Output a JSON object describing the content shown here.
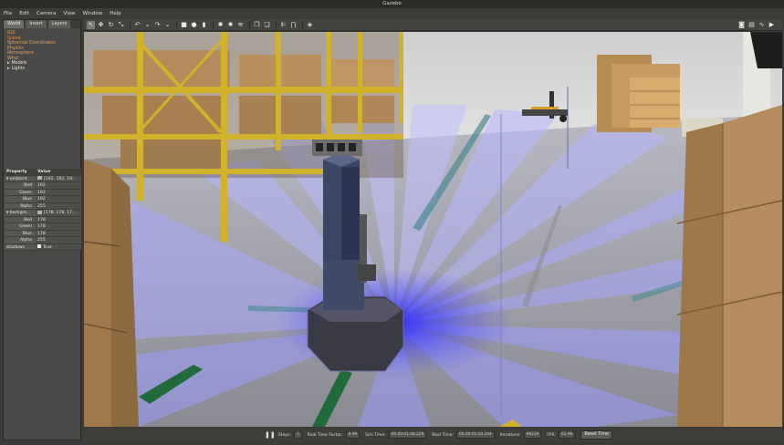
{
  "window": {
    "title": "Gazebo"
  },
  "menu": [
    "File",
    "Edit",
    "Camera",
    "View",
    "Window",
    "Help"
  ],
  "left_panel": {
    "tabs": [
      "World",
      "Insert",
      "Layers"
    ],
    "tree": [
      {
        "label": "GUI",
        "style": "orange"
      },
      {
        "label": "Scene",
        "style": "selected"
      },
      {
        "label": "Spherical Coordinates",
        "style": "orange"
      },
      {
        "label": "Physics",
        "style": "orange"
      },
      {
        "label": "Atmosphere",
        "style": "orange"
      },
      {
        "label": "Wind",
        "style": "orange"
      },
      {
        "label": "Models",
        "style": "expand"
      },
      {
        "label": "Lights",
        "style": "expand"
      }
    ],
    "properties": {
      "header": {
        "property": "Property",
        "value": "Value"
      },
      "rows": [
        {
          "key": "ambient",
          "value": "[192, 192, 19...",
          "type": "group"
        },
        {
          "key": "Red",
          "value": "192",
          "type": "child"
        },
        {
          "key": "Green",
          "value": "192",
          "type": "child"
        },
        {
          "key": "Blue",
          "value": "192",
          "type": "child"
        },
        {
          "key": "Alpha",
          "value": "255",
          "type": "child"
        },
        {
          "key": "backgro...",
          "value": "[178, 178, 17...",
          "type": "group"
        },
        {
          "key": "Red",
          "value": "178",
          "type": "child"
        },
        {
          "key": "Green",
          "value": "178",
          "type": "child"
        },
        {
          "key": "Blue",
          "value": "178",
          "type": "child"
        },
        {
          "key": "Alpha",
          "value": "255",
          "type": "child"
        },
        {
          "key": "shadows",
          "value": "True",
          "type": "check"
        }
      ]
    }
  },
  "toolbar": {
    "tools": [
      {
        "name": "select-icon",
        "glyph": "↖",
        "active": true
      },
      {
        "name": "translate-icon",
        "glyph": "✥"
      },
      {
        "name": "rotate-icon",
        "glyph": "↻"
      },
      {
        "name": "scale-icon",
        "glyph": "⤡"
      },
      {
        "name": "sep"
      },
      {
        "name": "undo-icon",
        "glyph": "↶"
      },
      {
        "name": "undo-dropdown-icon",
        "glyph": "⌄"
      },
      {
        "name": "redo-icon",
        "glyph": "↷"
      },
      {
        "name": "redo-dropdown-icon",
        "glyph": "⌄"
      },
      {
        "name": "sep"
      },
      {
        "name": "box-shape-icon",
        "glyph": "■"
      },
      {
        "name": "sphere-shape-icon",
        "glyph": "●"
      },
      {
        "name": "cylinder-shape-icon",
        "glyph": "▮"
      },
      {
        "name": "sep"
      },
      {
        "name": "point-light-icon",
        "glyph": "✺"
      },
      {
        "name": "spot-light-icon",
        "glyph": "✹"
      },
      {
        "name": "directional-light-icon",
        "glyph": "≋"
      },
      {
        "name": "sep"
      },
      {
        "name": "copy-icon",
        "glyph": "❐"
      },
      {
        "name": "paste-icon",
        "glyph": "❏"
      },
      {
        "name": "sep"
      },
      {
        "name": "align-icon",
        "glyph": "⊫"
      },
      {
        "name": "snap-icon",
        "glyph": "⋂"
      },
      {
        "name": "sep"
      },
      {
        "name": "view-angle-icon",
        "glyph": "◈"
      }
    ],
    "right_tools": [
      {
        "name": "screenshot-icon",
        "glyph": "◙"
      },
      {
        "name": "log-icon",
        "glyph": "▤"
      },
      {
        "name": "plot-icon",
        "glyph": "∿"
      },
      {
        "name": "video-record-icon",
        "glyph": "▶"
      }
    ]
  },
  "bottom_bar": {
    "steps_label": "Steps:",
    "steps_value": "1",
    "rtf_label": "Real Time Factor:",
    "rtf_value": "0.98",
    "sim_time_label": "Sim Time:",
    "sim_time_value": "00 00:01:08.229",
    "real_time_label": "Real Time:",
    "real_time_value": "00 00:01:10.244",
    "iterations_label": "Iterations:",
    "iterations_value": "68229",
    "fps_label": "FPS:",
    "fps_value": "62.96",
    "reset_label": "Reset Time"
  },
  "colors": {
    "laser": "#3c3cff",
    "floor": "#d6d6e6",
    "shelf": "#d2b22a",
    "box": "#b48b5c",
    "robot": "#3f4a66"
  }
}
